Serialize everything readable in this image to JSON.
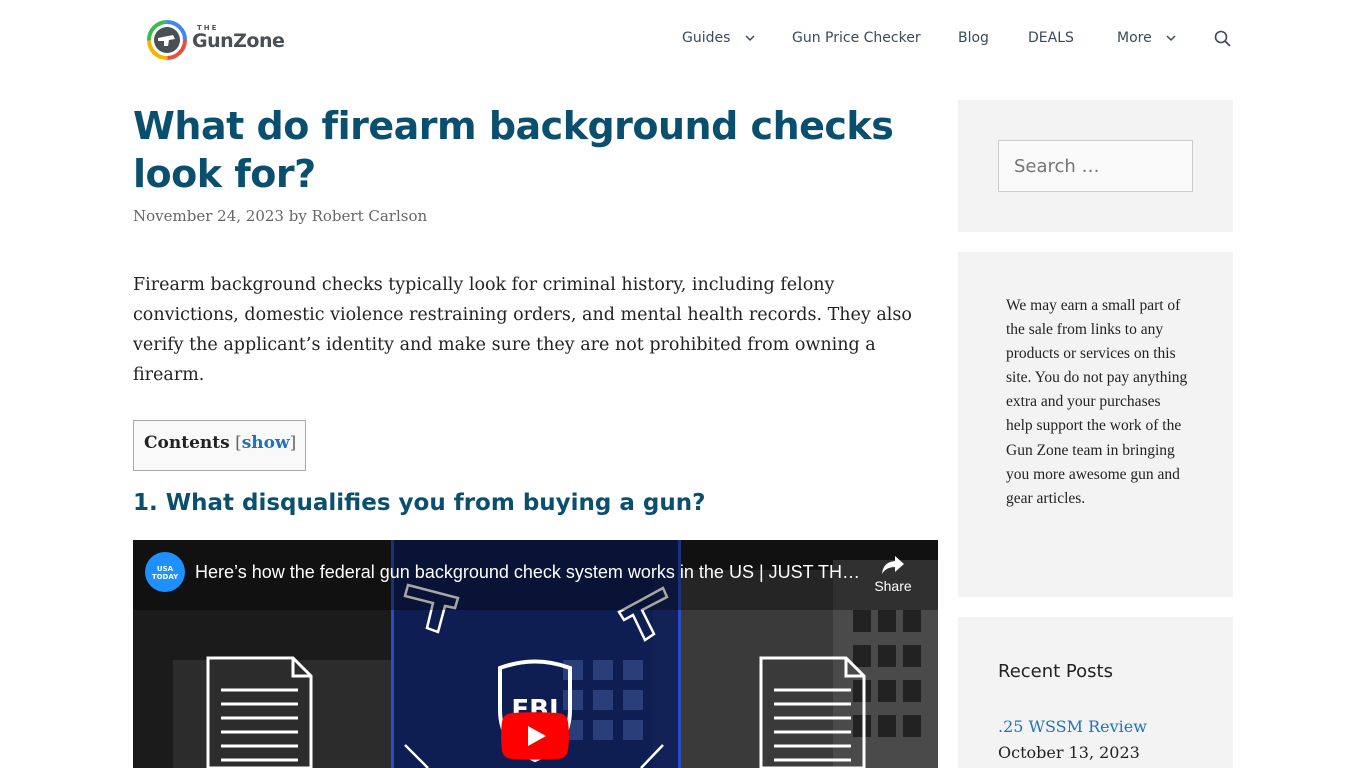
{
  "site": {
    "logo_small": "THE",
    "logo_name": "GunZone"
  },
  "nav": {
    "items": [
      {
        "label": "Guides",
        "dropdown": true
      },
      {
        "label": "Gun Price Checker",
        "dropdown": false
      },
      {
        "label": "Blog",
        "dropdown": false
      },
      {
        "label": "DEALS",
        "dropdown": false
      },
      {
        "label": "More",
        "dropdown": true
      }
    ],
    "search_icon": "search-icon"
  },
  "article": {
    "title": "What do firearm background checks look for?",
    "date": "November 24, 2023",
    "by": "by",
    "author": "Robert Carlson",
    "intro": "Firearm background checks typically look for criminal history, including felony convictions, domestic violence restraining orders, and mental health records. They also verify the applicant’s identity and make sure they are not prohibited from owning a firearm.",
    "toc": {
      "title": "Contents",
      "open_bracket": "[",
      "toggle": "show",
      "close_bracket": "]"
    },
    "heading_1": "1. What disqualifies you from buying a gun?"
  },
  "video": {
    "channel_badge": "USA TODAY",
    "title": "Here’s how the federal gun background check system works in the US | JUST THE...",
    "share_label": "Share",
    "badge_text": "FBI",
    "play_icon": "youtube-play-icon",
    "accent_color": "#ff0000"
  },
  "sidebar": {
    "search_placeholder": "Search …",
    "disclaimer": "We may earn a small part of the sale from links to any products or services on this site. You do not pay anything extra and your purchases help support the work of the Gun Zone team in bringing you more awesome gun and gear articles.",
    "recent_title": "Recent Posts",
    "recent": [
      {
        "title": ".25 WSSM Review",
        "date": "October 13, 2023"
      }
    ]
  },
  "colors": {
    "title": "#0a4f6e",
    "link": "#1e73be",
    "sidebar_bg": "#f3f3f3"
  }
}
